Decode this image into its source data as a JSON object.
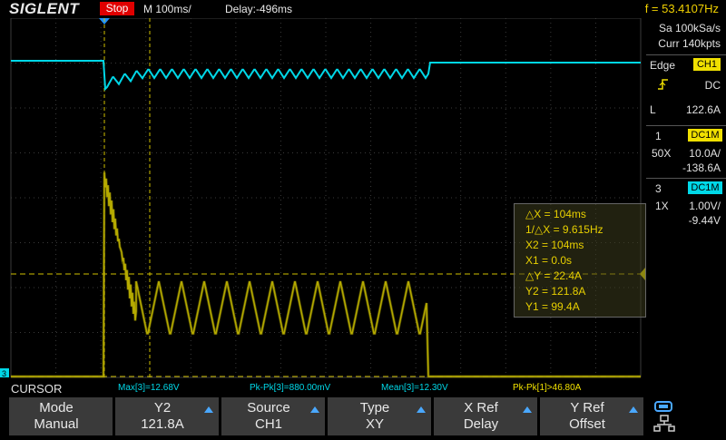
{
  "header": {
    "logo": "SIGLENT",
    "run_state": "Stop",
    "timebase": "M 100ms/",
    "delay": "Delay:-496ms",
    "frequency": "f = 53.4107Hz"
  },
  "acquisition": {
    "sample_rate": "Sa 100kSa/s",
    "memory_depth": "Curr 140kpts"
  },
  "trigger": {
    "type": "Edge",
    "source": "CH1",
    "coupling": "DC",
    "level_prefix": "L",
    "level": "122.6A"
  },
  "channels": [
    {
      "number": "1",
      "coupling": "DC1M",
      "probe": "50X",
      "scale": "10.0A/",
      "offset": "-138.6A",
      "color": "#f0e000"
    },
    {
      "number": "3",
      "coupling": "DC1M",
      "probe": "1X",
      "scale": "1.00V/",
      "offset": "-9.44V",
      "color": "#00d8e8"
    }
  ],
  "cursor_readout": {
    "delta_x": "△X = 104ms",
    "inv_delta_x": "1/△X = 9.615Hz",
    "x2": "X2 = 104ms",
    "x1": "X1 = 0.0s",
    "delta_y": "△Y = 22.4A",
    "y2": "Y2 = 121.8A",
    "y1": "Y1 = 99.4A"
  },
  "measurements": [
    {
      "text": "Max[3]=12.68V",
      "color": "#00d8e8"
    },
    {
      "text": "Pk-Pk[3]=880.00mV",
      "color": "#00d8e8"
    },
    {
      "text": "Mean[3]=12.30V",
      "color": "#00d8e8"
    },
    {
      "text": "Pk-Pk[1]>46.80A",
      "color": "#f0e000"
    }
  ],
  "menu_title": "CURSOR",
  "softkeys": [
    {
      "title": "Mode",
      "value": "Manual",
      "arrow": false
    },
    {
      "title": "Y2",
      "value": "121.8A",
      "arrow": true
    },
    {
      "title": "Source",
      "value": "CH1",
      "arrow": true
    },
    {
      "title": "Type",
      "value": "XY",
      "arrow": true
    },
    {
      "title": "X Ref",
      "value": "Delay",
      "arrow": true
    },
    {
      "title": "Y Ref",
      "value": "Offset",
      "arrow": true
    }
  ],
  "marker_label": "3",
  "colors": {
    "ch1": "#f0e000",
    "ch3": "#00d8e8",
    "trigger_marker": "#1e90ff",
    "accent": "#4aa8ff"
  }
}
